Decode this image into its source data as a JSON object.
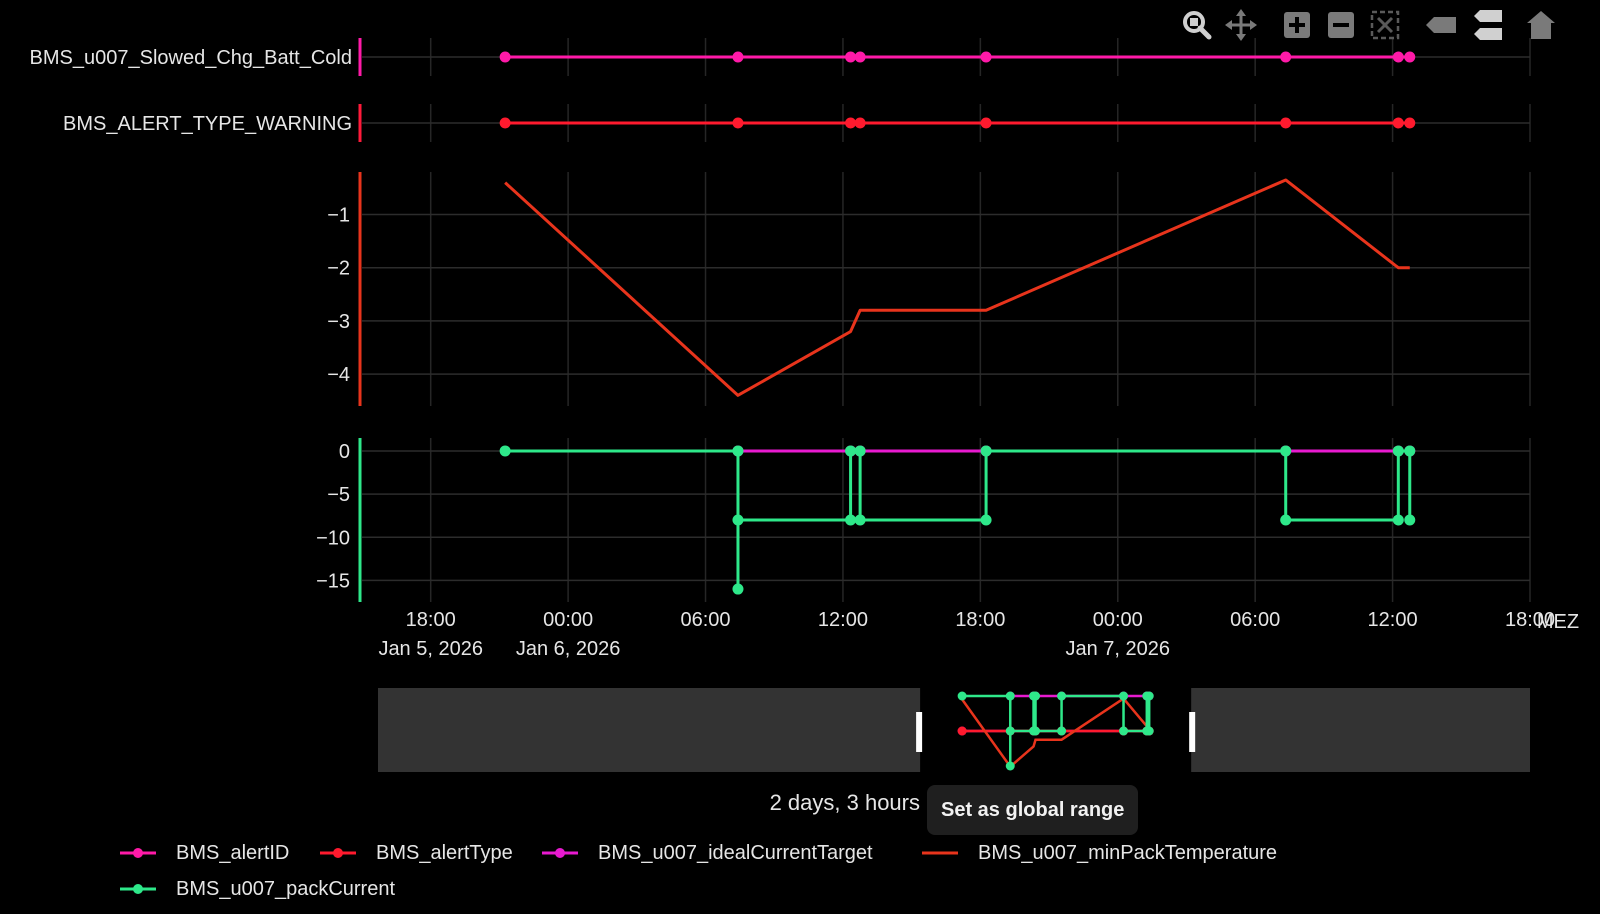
{
  "chart_data": {
    "type": "line",
    "time_zone_label": "MEZ",
    "x_ticks": [
      {
        "time": "2026-01-05 18:00",
        "label": "18:00",
        "date_label": "Jan 5, 2026"
      },
      {
        "time": "2026-01-06 00:00",
        "label": "00:00",
        "date_label": "Jan 6, 2026"
      },
      {
        "time": "2026-01-06 06:00",
        "label": "06:00",
        "date_label": ""
      },
      {
        "time": "2026-01-06 12:00",
        "label": "12:00",
        "date_label": ""
      },
      {
        "time": "2026-01-06 18:00",
        "label": "18:00",
        "date_label": ""
      },
      {
        "time": "2026-01-07 00:00",
        "label": "00:00",
        "date_label": "Jan 7, 2026"
      },
      {
        "time": "2026-01-07 06:00",
        "label": "06:00",
        "date_label": ""
      },
      {
        "time": "2026-01-07 12:00",
        "label": "12:00",
        "date_label": ""
      },
      {
        "time": "2026-01-07 18:00",
        "label": "18:00",
        "date_label": ""
      }
    ],
    "x_range": [
      "2026-01-05 15:00",
      "2026-01-07 18:00"
    ],
    "panels": [
      {
        "id": "alert-id",
        "category_label": "BMS_u007_Slowed_Chg_Batt_Cold",
        "axis_color": "#ff1aa8",
        "series": [
          {
            "name": "BMS_alertID",
            "color": "#ff1aa8",
            "markers": true,
            "x": [
              "2026-01-05 21:15",
              "2026-01-06 07:25",
              "2026-01-06 12:20",
              "2026-01-06 12:45",
              "2026-01-06 18:15",
              "2026-01-07 07:20",
              "2026-01-07 12:15",
              "2026-01-07 12:45"
            ],
            "y": [
              1,
              1,
              1,
              1,
              1,
              1,
              1,
              1
            ]
          }
        ]
      },
      {
        "id": "alert-type",
        "category_label": "BMS_ALERT_TYPE_WARNING",
        "axis_color": "#ff1a3a",
        "series": [
          {
            "name": "BMS_alertType",
            "color": "#ff1a2e",
            "markers": true,
            "x": [
              "2026-01-05 21:15",
              "2026-01-06 07:25",
              "2026-01-06 12:20",
              "2026-01-06 12:45",
              "2026-01-06 18:15",
              "2026-01-07 07:20",
              "2026-01-07 12:15",
              "2026-01-07 12:45"
            ],
            "y": [
              1,
              1,
              1,
              1,
              1,
              1,
              1,
              1
            ]
          }
        ]
      },
      {
        "id": "min-pack-temperature",
        "axis_color": "#e8341c",
        "ylim": [
          -4.6,
          -0.2
        ],
        "y_ticks": [
          -1,
          -2,
          -3,
          -4
        ],
        "series": [
          {
            "name": "BMS_u007_minPackTemperature",
            "color": "#e8341c",
            "markers": false,
            "x": [
              "2026-01-05 21:15",
              "2026-01-06 07:25",
              "2026-01-06 12:20",
              "2026-01-06 12:45",
              "2026-01-06 18:15",
              "2026-01-07 07:20",
              "2026-01-07 12:15",
              "2026-01-07 12:45"
            ],
            "y": [
              -0.4,
              -4.4,
              -3.2,
              -2.8,
              -2.8,
              -0.35,
              -2.0,
              -2.0
            ]
          }
        ]
      },
      {
        "id": "current",
        "axis_color": "#2ee88a",
        "ylim": [
          -17.5,
          1.5
        ],
        "y_ticks": [
          0,
          -5,
          -10,
          -15
        ],
        "series": [
          {
            "name": "BMS_u007_idealCurrentTarget",
            "color": "#e81ad0",
            "markers": true,
            "step": false,
            "x": [
              "2026-01-06 07:25",
              "2026-01-06 12:20",
              "2026-01-06 12:45",
              "2026-01-06 18:15",
              "2026-01-07 07:20",
              "2026-01-07 12:15",
              "2026-01-07 12:45"
            ],
            "y": [
              0,
              0,
              0,
              0,
              0,
              0,
              0
            ]
          },
          {
            "name": "BMS_u007_packCurrent",
            "color": "#2ee88a",
            "markers": true,
            "step": true,
            "x": [
              "2026-01-05 21:15",
              "2026-01-06 07:25",
              "2026-01-06 07:25",
              "2026-01-06 07:25",
              "2026-01-06 12:20",
              "2026-01-06 12:20",
              "2026-01-06 12:45",
              "2026-01-06 12:45",
              "2026-01-06 18:15",
              "2026-01-06 18:15",
              "2026-01-07 07:20",
              "2026-01-07 07:20",
              "2026-01-07 12:15",
              "2026-01-07 12:15",
              "2026-01-07 12:45",
              "2026-01-07 12:45"
            ],
            "y": [
              0,
              0,
              -16,
              -8,
              -8,
              0,
              0,
              -8,
              -8,
              0,
              0,
              -8,
              -8,
              0,
              0,
              -8
            ]
          }
        ]
      }
    ],
    "range_selector": {
      "window_start": "2026-01-06 15:00",
      "window_end": "2026-01-07 03:00"
    },
    "grid": true,
    "legend_position": "bottom"
  },
  "range_info": {
    "duration": "2 days, 3 hours",
    "set_global_label": "Set as global range"
  },
  "legend": [
    {
      "name": "BMS_alertID",
      "color": "#ff1aa8"
    },
    {
      "name": "BMS_alertType",
      "color": "#ff1a2e"
    },
    {
      "name": "BMS_u007_idealCurrentTarget",
      "color": "#e81ad0"
    },
    {
      "name": "BMS_u007_minPackTemperature",
      "color": "#e8341c"
    },
    {
      "name": "BMS_u007_packCurrent",
      "color": "#2ee88a"
    }
  ],
  "modebar": [
    {
      "icon": "zoom-icon"
    },
    {
      "icon": "pan-icon"
    },
    {
      "icon": "zoom-in-icon"
    },
    {
      "icon": "zoom-out-icon"
    },
    {
      "icon": "autoscale-icon"
    },
    {
      "icon": "hover-closest-icon"
    },
    {
      "icon": "hover-compare-icon"
    },
    {
      "icon": "reset-axes-icon"
    }
  ]
}
